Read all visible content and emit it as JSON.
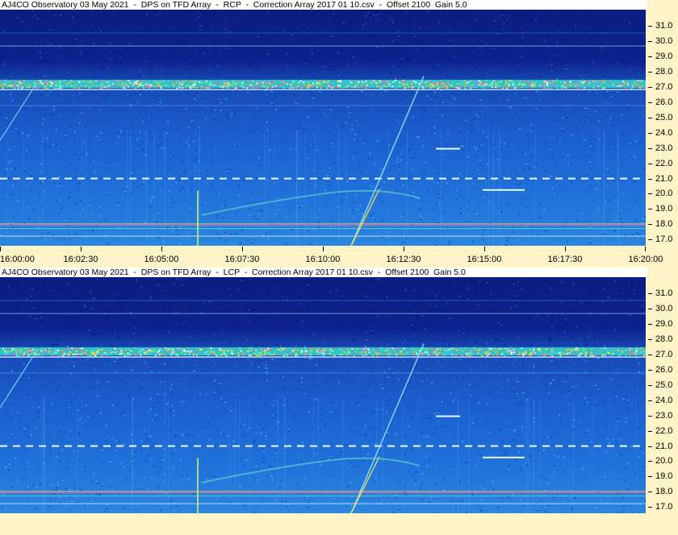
{
  "panels": [
    {
      "title": "AJ4CO Observatory 03 May 2021  -  DPS on TFD Array  -  RCP  -  Correction Array 2017 01 10.csv  -  Offset 2100  Gain 5.0",
      "polarization": "RCP"
    },
    {
      "title": "AJ4CO Observatory 03 May 2021  -  DPS on TFD Array  -  LCP  -  Correction Array 2017 01 10.csv  -  Offset 2100  Gain 5.0",
      "polarization": "LCP"
    }
  ],
  "y_axis": {
    "ticks": [
      "31.0",
      "30.0",
      "29.0",
      "28.0",
      "27.0",
      "26.0",
      "25.0",
      "24.0",
      "23.0",
      "22.0",
      "21.0",
      "20.0",
      "19.0",
      "18.0",
      "17.0"
    ]
  },
  "x_axis": {
    "ticks": [
      "16:00:00",
      "16:02:30",
      "16:05:00",
      "16:07:30",
      "16:10:00",
      "16:12:30",
      "16:15:00",
      "16:17:30",
      "16:20:00"
    ]
  },
  "colors": {
    "background": "#fff3c8",
    "spectrogram_low": "#0a1f8a",
    "spectrogram_mid": "#1a6ad8",
    "spectrogram_high": "#2fb8e8",
    "rfi_band": "#ff5ad8"
  }
}
